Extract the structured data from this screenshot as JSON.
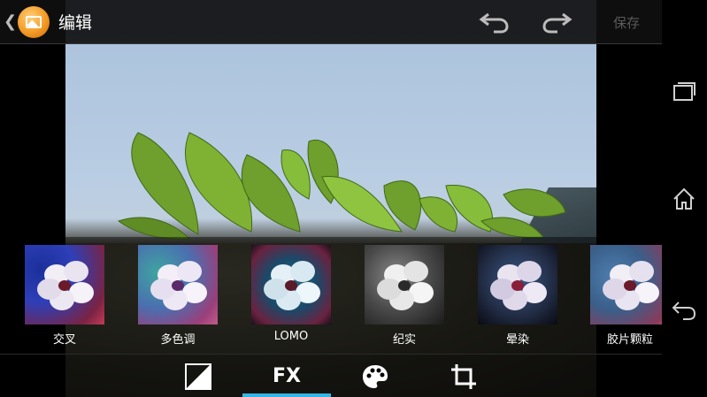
{
  "header": {
    "title": "编辑",
    "save_label": "保存",
    "back_glyph": "❮"
  },
  "icons": {
    "app": "gallery-app-icon",
    "undo": "undo-icon",
    "redo": "redo-icon",
    "recents": "recent-apps-icon",
    "home": "home-icon",
    "back": "back-icon",
    "exposure": "exposure-icon",
    "palette": "palette-icon",
    "crop": "crop-icon"
  },
  "filters": [
    {
      "label": "交叉"
    },
    {
      "label": "多色调"
    },
    {
      "label": "LOMO"
    },
    {
      "label": "纪实"
    },
    {
      "label": "晕染"
    },
    {
      "label": "胶片颗粒"
    }
  ],
  "tools": {
    "fx_label": "FX",
    "active_tab": "FX"
  },
  "colors": {
    "accent": "#33b5e5",
    "save_disabled": "#5a5a5a"
  }
}
